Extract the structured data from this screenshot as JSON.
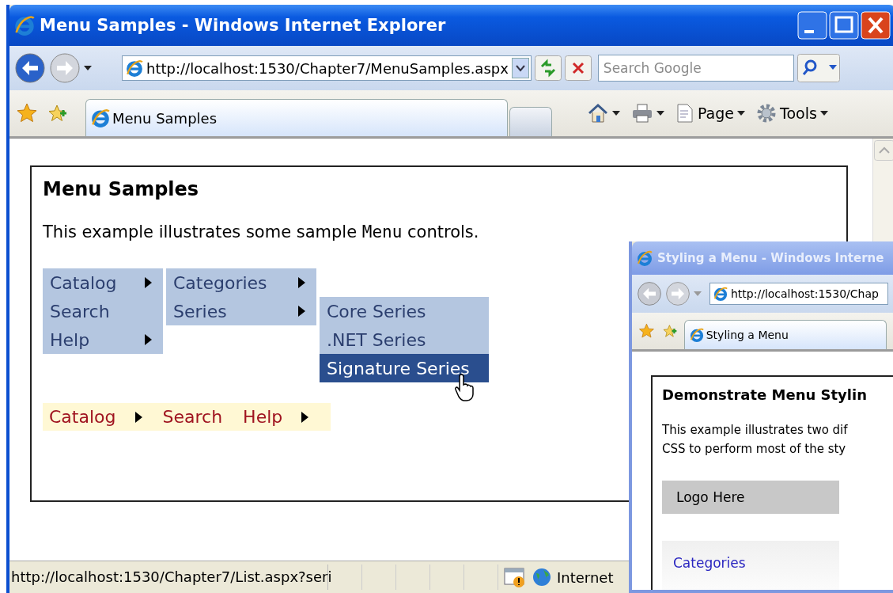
{
  "main_window": {
    "active": true,
    "title": "Menu Samples - Windows Internet Explorer",
    "address": "http://localhost:1530/Chapter7/MenuSamples.aspx",
    "search": {
      "placeholder": "Search Google"
    },
    "tabs": [
      {
        "label": "Menu Samples",
        "selected": true
      }
    ],
    "command_bar": [
      {
        "kind": "home"
      },
      {
        "kind": "print"
      },
      {
        "kind": "page",
        "label": "Page"
      },
      {
        "kind": "tools",
        "label": "Tools"
      }
    ],
    "page": {
      "heading": "Menu Samples",
      "intro": [
        {
          "kind": "text",
          "text": "This example illustrates some sample "
        },
        {
          "kind": "code",
          "text": "Menu"
        },
        {
          "kind": "text",
          "text": " controls."
        }
      ],
      "vertical_menu": [
        {
          "label": "Catalog",
          "has_submenu": true
        },
        {
          "label": "Search",
          "has_submenu": false
        },
        {
          "label": "Help",
          "has_submenu": true
        }
      ],
      "submenu": [
        {
          "label": "Categories",
          "has_submenu": true
        },
        {
          "label": "Series",
          "has_submenu": true
        }
      ],
      "series_submenu": [
        {
          "label": "Core Series",
          "selected": false
        },
        {
          "label": ".NET Series",
          "selected": false
        },
        {
          "label": "Signature Series",
          "selected": true
        }
      ],
      "horizontal_menu": [
        {
          "label": "Catalog",
          "has_submenu": true
        },
        {
          "label": "Search",
          "has_submenu": false
        },
        {
          "label": "Help",
          "has_submenu": true
        }
      ]
    },
    "status_bar": {
      "text": "http://localhost:1530/Chapter7/List.aspx?seri",
      "zone": "Internet"
    }
  },
  "second_window": {
    "active": false,
    "title": "Styling a Menu - Windows Interne",
    "address": "http://localhost:1530/Chap",
    "tabs": [
      {
        "label": "Styling a Menu",
        "selected": true
      }
    ],
    "page": {
      "heading": "Demonstrate Menu Stylin",
      "intro_lines": [
        "This example illustrates two dif",
        "CSS to perform most of the sty"
      ],
      "logo": "Logo Here",
      "menu": [
        {
          "label": "Categories"
        }
      ]
    }
  }
}
